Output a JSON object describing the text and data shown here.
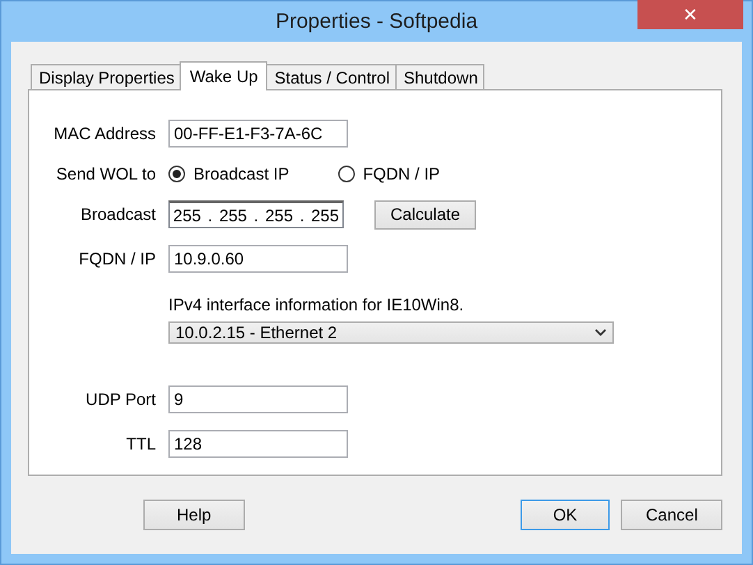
{
  "window": {
    "title": "Properties - Softpedia",
    "close": "✕"
  },
  "tabs": [
    {
      "label": "Display Properties",
      "selected": false
    },
    {
      "label": "Wake Up",
      "selected": true
    },
    {
      "label": "Status / Control",
      "selected": false
    },
    {
      "label": "Shutdown",
      "selected": false
    }
  ],
  "rows": [
    {
      "kind": "text",
      "label": "MAC Address",
      "value": "00-FF-E1-F3-7A-6C"
    },
    {
      "kind": "radio",
      "label": "Send WOL to",
      "options": [
        {
          "label": "Broadcast IP",
          "selected": true
        },
        {
          "label": "FQDN / IP",
          "selected": false
        }
      ]
    },
    {
      "kind": "ip",
      "label": "Broadcast",
      "octets": [
        "255",
        "255",
        "255",
        "255"
      ],
      "separators": [
        ".",
        ".",
        "."
      ],
      "button": "Calculate"
    },
    {
      "kind": "text",
      "label": "FQDN / IP",
      "value": "10.9.0.60"
    },
    {
      "kind": "note",
      "text": "IPv4 interface information for IE10Win8."
    },
    {
      "kind": "select",
      "value": "10.0.2.15 - Ethernet 2"
    },
    {
      "kind": "text",
      "label": "UDP Port",
      "value": "9"
    },
    {
      "kind": "text",
      "label": "TTL",
      "value": "128"
    }
  ],
  "buttons": [
    {
      "label": "Help",
      "default": false
    },
    {
      "label": "OK",
      "default": true
    },
    {
      "label": "Cancel",
      "default": false
    }
  ]
}
